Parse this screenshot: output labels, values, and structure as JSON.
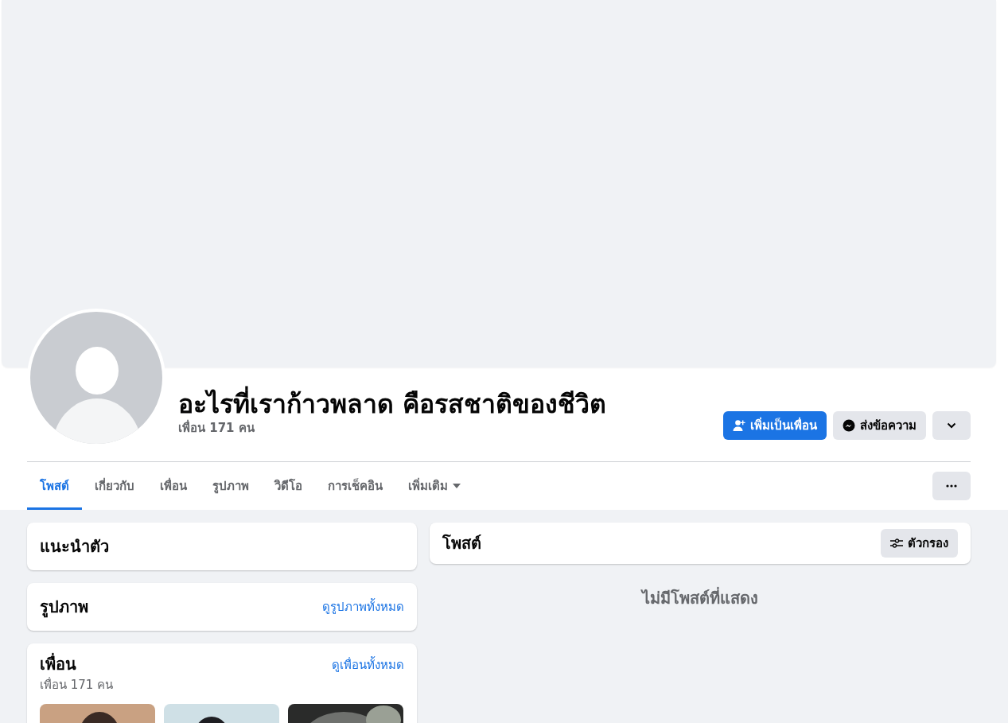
{
  "profile": {
    "name": "อะไรที่เราก้าวพลาด คือรสชาติของชีวิต",
    "friends_count": "เพื่อน 171 คน"
  },
  "actions": [
    {
      "kind": "primary",
      "label": "เพิ่มเป็นเพื่อน"
    },
    {
      "kind": "secondary",
      "label": "ส่งข้อความ"
    },
    {
      "kind": "menu"
    }
  ],
  "tabs": [
    {
      "label": "โพสต์",
      "selected": true,
      "kind": "link"
    },
    {
      "label": "เกี่ยวกับ",
      "selected": false,
      "kind": "link"
    },
    {
      "label": "เพื่อน",
      "selected": false,
      "kind": "link"
    },
    {
      "label": "รูปภาพ",
      "selected": false,
      "kind": "link"
    },
    {
      "label": "วิดีโอ",
      "selected": false,
      "kind": "link"
    },
    {
      "label": "การเช็คอิน",
      "selected": false,
      "kind": "link"
    },
    {
      "label": "เพิ่มเติม",
      "selected": false,
      "kind": "dropdown"
    }
  ],
  "intro": {
    "title": "แนะนำตัว"
  },
  "photos": {
    "title": "รูปภาพ",
    "link": "ดูรูปภาพทั้งหมด"
  },
  "friends": {
    "title": "เพื่อน",
    "link": "ดูเพื่อนทั้งหมด",
    "count": "เพื่อน 171 คน"
  },
  "posts": {
    "title": "โพสต์",
    "filter": "ตัวกรอง",
    "empty": "ไม่มีโพสต์ที่แสดง"
  }
}
